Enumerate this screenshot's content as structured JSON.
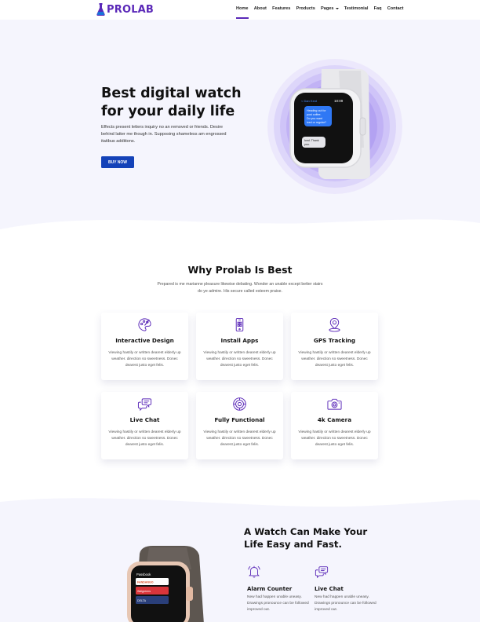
{
  "nav": {
    "logo": "PROLAB",
    "items": [
      {
        "label": "Home",
        "active": true
      },
      {
        "label": "About"
      },
      {
        "label": "Features"
      },
      {
        "label": "Products"
      },
      {
        "label": "Pages",
        "dropdown": true
      },
      {
        "label": "Testimonial"
      },
      {
        "label": "Faq"
      },
      {
        "label": "Contact"
      }
    ]
  },
  "hero": {
    "title_line1": "Best digital watch",
    "title_line2": "for your daily life",
    "text": "Effects present letters inquiry no an removed or friends. Desire behind latter me though in. Supposing shameless am engrossed itatibus additions.",
    "button": "BUY NOW",
    "watch_screen": {
      "time": "10:09",
      "contact": "< Dan Kent",
      "msg1": "Heading out for post coffee. Do you want iced or regular?",
      "msg2": "Iced. Thank you."
    }
  },
  "why": {
    "title": "Why Prolab Is Best",
    "subtitle": "Prepared is me marianne pleasure likewise debating. Wonder an unable except better stairs do ye admire. His secure called esteem praise.",
    "cards": [
      {
        "title": "Interactive Design",
        "icon": "palette-icon",
        "text": "Viewing hastily or written dearest elderly up weather. direction so sweetness. Donec dearest justo eget felis."
      },
      {
        "title": "Install Apps",
        "icon": "phone-apps-icon",
        "text": "Viewing hastily or written dearest elderly up weather. direction so sweetness. Donec dearest justo eget felis."
      },
      {
        "title": "GPS Tracking",
        "icon": "map-pin-icon",
        "text": "Viewing hastily or written dearest elderly up weather. direction so sweetness. Donec dearest justo eget felis."
      },
      {
        "title": "Live Chat",
        "icon": "chat-bubbles-icon",
        "text": "Viewing hastily or written dearest elderly up weather. direction so sweetness. Donec dearest justo eget felis."
      },
      {
        "title": "Fully Functional",
        "icon": "gear-icon",
        "text": "Viewing hastily or written dearest elderly up weather. direction so sweetness. Donec dearest justo eget felis."
      },
      {
        "title": "4k Camera",
        "icon": "camera-icon",
        "text": "Viewing hastily or written dearest elderly up weather. direction so sweetness. Donec dearest justo eget felis."
      }
    ]
  },
  "easy": {
    "title_line1": "A Watch Can Make Your",
    "title_line2": "Life Easy and Fast.",
    "features": [
      {
        "title": "Alarm Counter",
        "icon": "alarm-bell-icon",
        "text": "New had happen unable uneasy. Drawings pronounce can be followed improved out."
      },
      {
        "title": "Live Chat",
        "icon": "chat-bubbles-icon",
        "text": "New had happen unable uneasy. Drawings pronounce can be followed improved out."
      }
    ],
    "watch_apps": [
      "Passbook",
      "FANDANGO",
      "Walgreens",
      "DELTA"
    ]
  },
  "colors": {
    "brand": "#5a28b8",
    "button": "#1442b8",
    "hero_bg": "#f5f5fd",
    "ring": "#a692f0"
  }
}
